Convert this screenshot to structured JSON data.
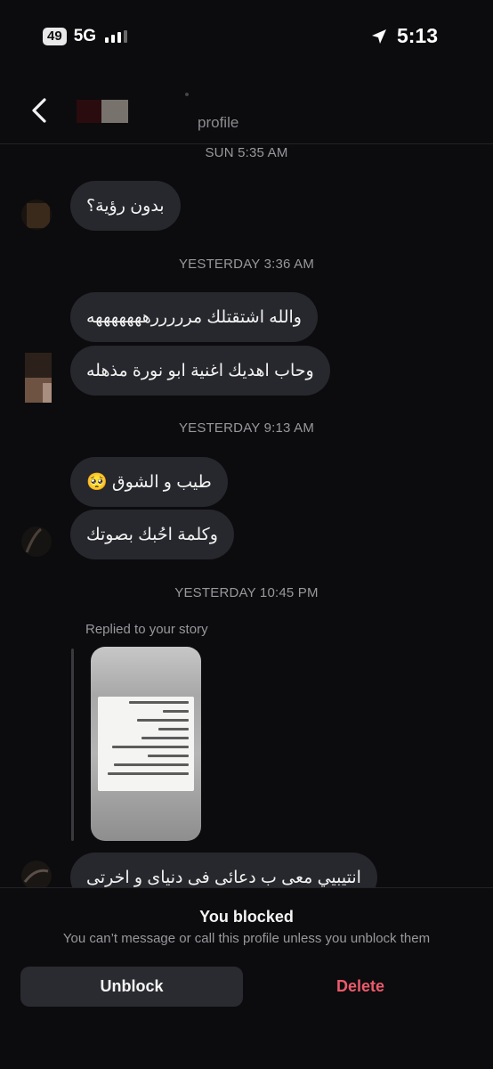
{
  "status_bar": {
    "battery": "49",
    "network": "5G",
    "time": "5:13"
  },
  "header": {
    "subtitle": "profile"
  },
  "timestamps": [
    "SUN 5:35 AM",
    "YESTERDAY 3:36 AM",
    "YESTERDAY 9:13 AM",
    "YESTERDAY 10:45 PM"
  ],
  "messages": [
    "بدون رؤية؟",
    "والله اشتقتلك مرررررهههههههه",
    "وحاب اهديك اغنية ابو نورة مذهله",
    "طيب و الشوق 🥺",
    "وكلمة احُبك بصوتك",
    "انتيبيي معى ب دعائى فى دنياى و اخرتى"
  ],
  "story_reply_label": "Replied to your story",
  "blocked_panel": {
    "title": "You blocked",
    "subtitle": "You can’t message or call this profile unless you unblock them",
    "unblock_label": "Unblock",
    "delete_label": "Delete",
    "delete_color": "#ed5a6b"
  }
}
